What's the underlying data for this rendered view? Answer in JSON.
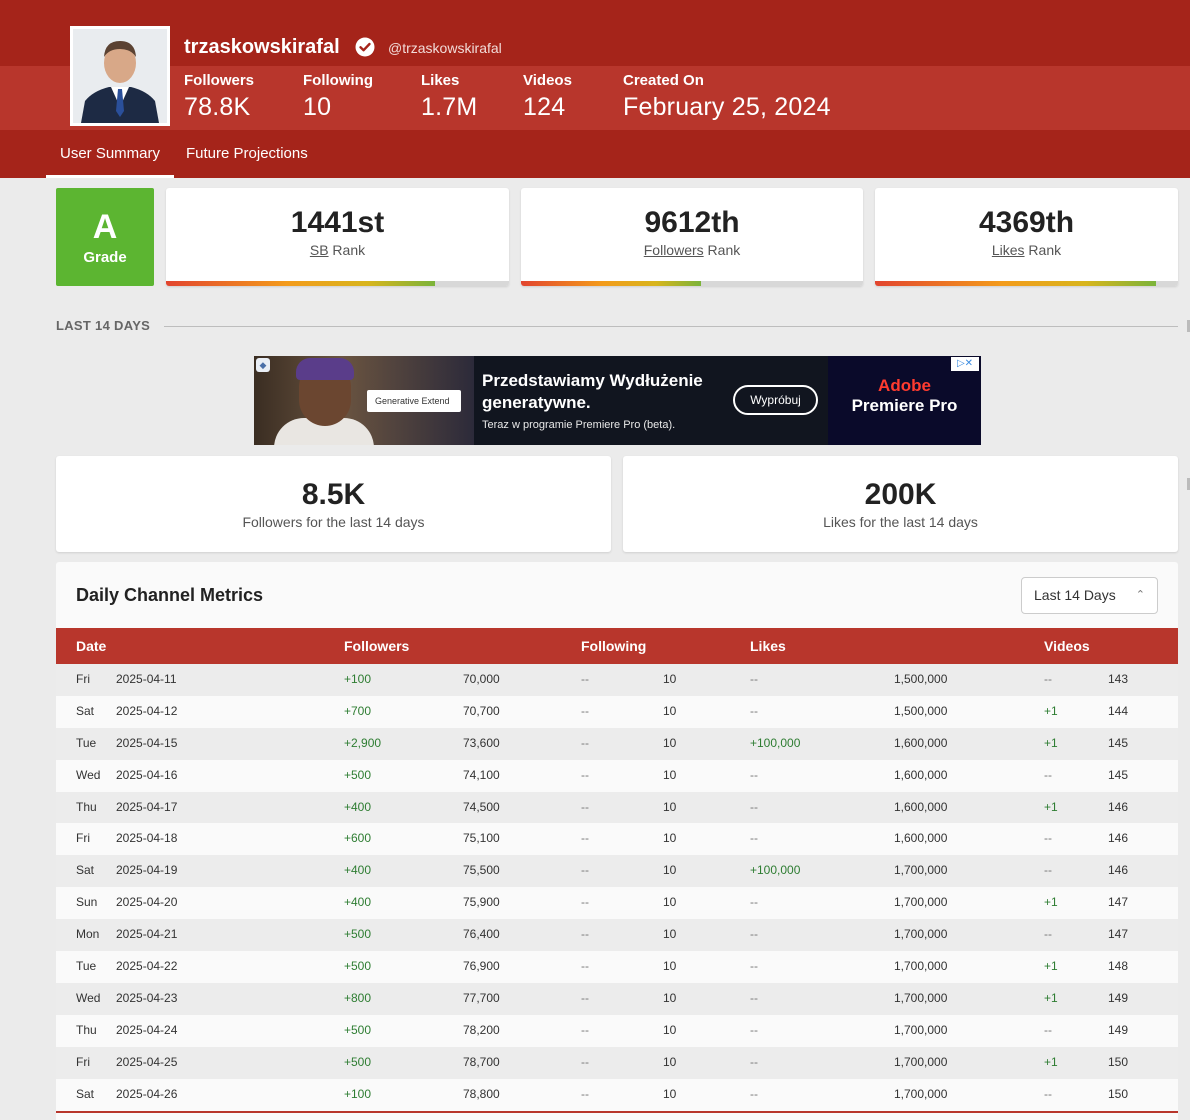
{
  "profile": {
    "username": "trzaskowskirafal",
    "handle": "@trzaskowskirafal",
    "stats": [
      {
        "label": "Followers",
        "value": "78.8K"
      },
      {
        "label": "Following",
        "value": "10"
      },
      {
        "label": "Likes",
        "value": "1.7M"
      },
      {
        "label": "Videos",
        "value": "124"
      },
      {
        "label": "Created On",
        "value": "February 25, 2024"
      }
    ]
  },
  "tabs": [
    {
      "label": "User Summary",
      "active": true
    },
    {
      "label": "Future Projections",
      "active": false
    }
  ],
  "grade": {
    "letter": "A",
    "label": "Grade",
    "color": "#5cb531"
  },
  "ranks": [
    {
      "value": "1441st",
      "link": "SB",
      "suffix": " Rank",
      "progress": 0.8
    },
    {
      "value": "9612th",
      "link": "Followers",
      "suffix": " Rank",
      "progress": 0.53
    },
    {
      "value": "4369th",
      "link": "Likes",
      "suffix": " Rank",
      "progress": 0.93
    }
  ],
  "section": {
    "title": "LAST 14 DAYS"
  },
  "ad": {
    "pill": "Generative Extend",
    "headline": "Przedstawiamy Wydłużenie generatywne.",
    "subline": "Teraz w programie Premiere Pro (beta).",
    "button": "Wypróbuj",
    "brand_top": "Adobe",
    "brand_bottom": "Premiere Pro"
  },
  "summary_cards": [
    {
      "value": "8.5K",
      "label": "Followers for the last 14 days"
    },
    {
      "value": "200K",
      "label": "Likes for the last 14 days"
    }
  ],
  "metrics": {
    "title": "Daily Channel Metrics",
    "range": "Last 14 Days",
    "headers": [
      "Date",
      "Followers",
      "Following",
      "Likes",
      "Videos"
    ],
    "rows": [
      {
        "day": "Fri",
        "date": "2025-04-11",
        "f_delta": "+100",
        "followers": "70,000",
        "fo_delta": "--",
        "following": "10",
        "l_delta": "--",
        "likes": "1,500,000",
        "v_delta": "--",
        "videos": "143"
      },
      {
        "day": "Sat",
        "date": "2025-04-12",
        "f_delta": "+700",
        "followers": "70,700",
        "fo_delta": "--",
        "following": "10",
        "l_delta": "--",
        "likes": "1,500,000",
        "v_delta": "+1",
        "videos": "144"
      },
      {
        "day": "Tue",
        "date": "2025-04-15",
        "f_delta": "+2,900",
        "followers": "73,600",
        "fo_delta": "--",
        "following": "10",
        "l_delta": "+100,000",
        "likes": "1,600,000",
        "v_delta": "+1",
        "videos": "145"
      },
      {
        "day": "Wed",
        "date": "2025-04-16",
        "f_delta": "+500",
        "followers": "74,100",
        "fo_delta": "--",
        "following": "10",
        "l_delta": "--",
        "likes": "1,600,000",
        "v_delta": "--",
        "videos": "145"
      },
      {
        "day": "Thu",
        "date": "2025-04-17",
        "f_delta": "+400",
        "followers": "74,500",
        "fo_delta": "--",
        "following": "10",
        "l_delta": "--",
        "likes": "1,600,000",
        "v_delta": "+1",
        "videos": "146"
      },
      {
        "day": "Fri",
        "date": "2025-04-18",
        "f_delta": "+600",
        "followers": "75,100",
        "fo_delta": "--",
        "following": "10",
        "l_delta": "--",
        "likes": "1,600,000",
        "v_delta": "--",
        "videos": "146"
      },
      {
        "day": "Sat",
        "date": "2025-04-19",
        "f_delta": "+400",
        "followers": "75,500",
        "fo_delta": "--",
        "following": "10",
        "l_delta": "+100,000",
        "likes": "1,700,000",
        "v_delta": "--",
        "videos": "146"
      },
      {
        "day": "Sun",
        "date": "2025-04-20",
        "f_delta": "+400",
        "followers": "75,900",
        "fo_delta": "--",
        "following": "10",
        "l_delta": "--",
        "likes": "1,700,000",
        "v_delta": "+1",
        "videos": "147"
      },
      {
        "day": "Mon",
        "date": "2025-04-21",
        "f_delta": "+500",
        "followers": "76,400",
        "fo_delta": "--",
        "following": "10",
        "l_delta": "--",
        "likes": "1,700,000",
        "v_delta": "--",
        "videos": "147"
      },
      {
        "day": "Tue",
        "date": "2025-04-22",
        "f_delta": "+500",
        "followers": "76,900",
        "fo_delta": "--",
        "following": "10",
        "l_delta": "--",
        "likes": "1,700,000",
        "v_delta": "+1",
        "videos": "148"
      },
      {
        "day": "Wed",
        "date": "2025-04-23",
        "f_delta": "+800",
        "followers": "77,700",
        "fo_delta": "--",
        "following": "10",
        "l_delta": "--",
        "likes": "1,700,000",
        "v_delta": "+1",
        "videos": "149"
      },
      {
        "day": "Thu",
        "date": "2025-04-24",
        "f_delta": "+500",
        "followers": "78,200",
        "fo_delta": "--",
        "following": "10",
        "l_delta": "--",
        "likes": "1,700,000",
        "v_delta": "--",
        "videos": "149"
      },
      {
        "day": "Fri",
        "date": "2025-04-25",
        "f_delta": "+500",
        "followers": "78,700",
        "fo_delta": "--",
        "following": "10",
        "l_delta": "--",
        "likes": "1,700,000",
        "v_delta": "+1",
        "videos": "150"
      },
      {
        "day": "Sat",
        "date": "2025-04-26",
        "f_delta": "+100",
        "followers": "78,800",
        "fo_delta": "--",
        "following": "10",
        "l_delta": "--",
        "likes": "1,700,000",
        "v_delta": "--",
        "videos": "150"
      }
    ]
  },
  "colors": {
    "header": "#a5241a",
    "header_band": "#b8362c",
    "table_header": "#b8362c",
    "positive": "#2e7d32"
  }
}
